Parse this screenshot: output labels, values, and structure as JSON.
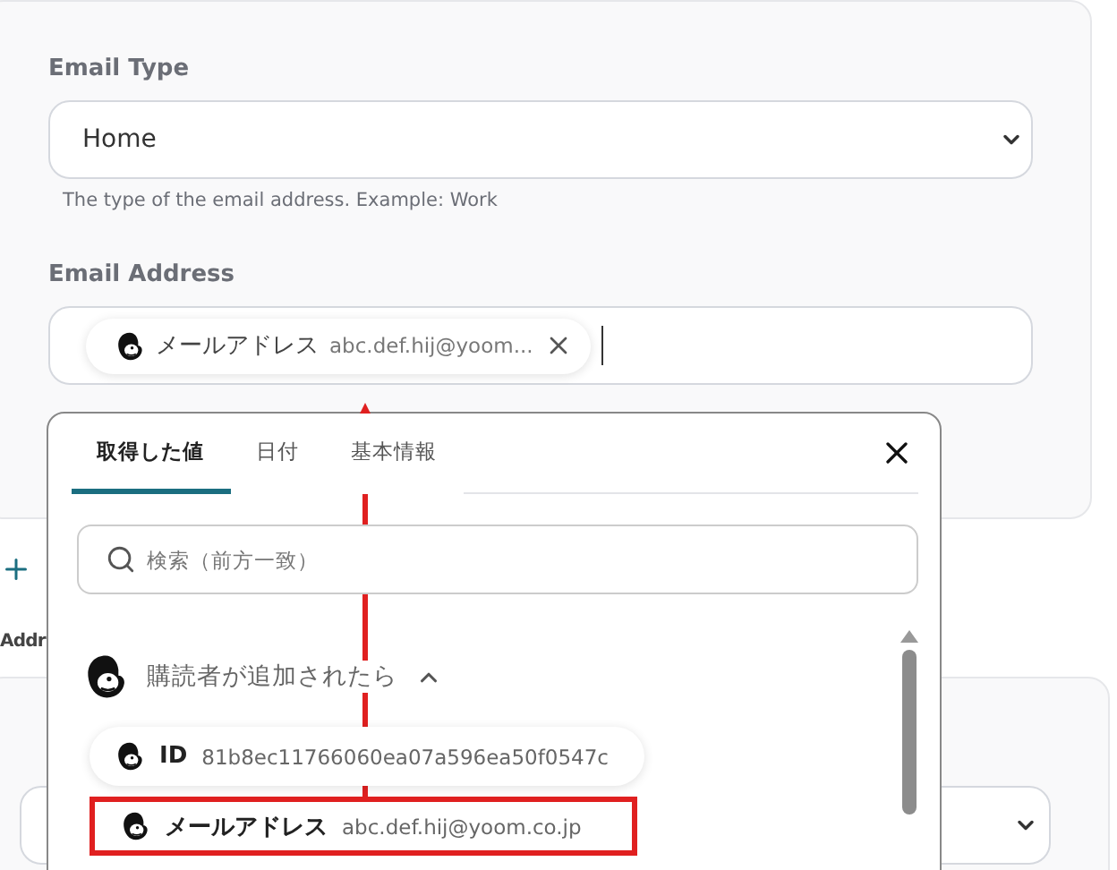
{
  "form_card": {
    "fields": [
      {
        "kind": "select",
        "label": "Email Type",
        "value": "Home",
        "hint": "The type of the email address. Example: Work"
      },
      {
        "kind": "tokens",
        "label": "Email Address",
        "tokens": [
          {
            "name": "メールアドレス",
            "value": "abc.def.hij@yoom..."
          }
        ]
      }
    ]
  },
  "section_label": "Addr",
  "picker": {
    "tabs": [
      {
        "label": "取得した値",
        "selected": true
      },
      {
        "label": "日付",
        "selected": false
      },
      {
        "label": "基本情報",
        "selected": false
      }
    ],
    "search": {
      "placeholder": "検索（前方一致）"
    },
    "groups": [
      {
        "title": "購読者が追加されたら",
        "expanded": true,
        "items": [
          {
            "name": "ID",
            "value": "81b8ec11766060ea07a596ea50f0547c",
            "highlighted": false
          },
          {
            "name": "メールアドレス",
            "value": "abc.def.hij@yoom.co.jp",
            "highlighted": true
          }
        ]
      }
    ]
  }
}
